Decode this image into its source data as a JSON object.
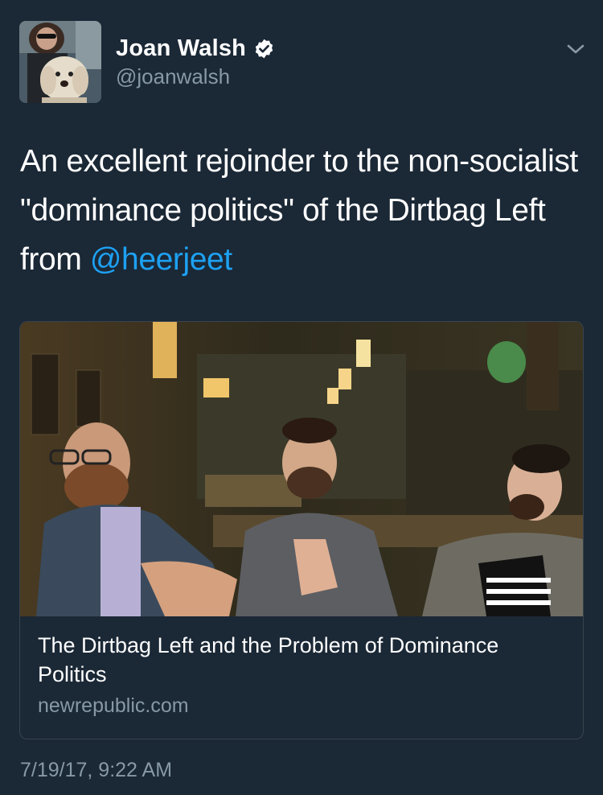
{
  "author": {
    "display_name": "Joan Walsh",
    "handle": "@joanwalsh",
    "verified": true
  },
  "tweet": {
    "text_before": "An excellent rejoinder to the non-socialist \"dominance politics\" of the Dirtbag Left from ",
    "mention": "@heerjeet",
    "timestamp": "7/19/17, 9:22 AM"
  },
  "card": {
    "title": "The Dirtbag Left and the Problem of Dominance Politics",
    "domain": "newrepublic.com"
  },
  "icons": {
    "verified": "verified-badge-icon",
    "menu": "chevron-down-icon"
  },
  "colors": {
    "background": "#1b2836",
    "link": "#1da1f2",
    "secondary_text": "#8899a6",
    "card_border": "#38444d"
  }
}
